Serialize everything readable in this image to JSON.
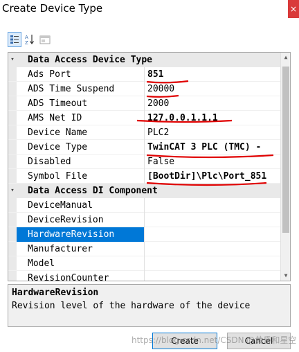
{
  "window": {
    "title": "Create Device Type",
    "close_glyph": "×"
  },
  "toolbar": {
    "categorized_icon": "categorized-view-icon",
    "alphabetical_icon": "alphabetical-sort-icon",
    "property_pages_icon": "property-pages-icon"
  },
  "grid": {
    "categories": [
      {
        "label": "Data Access Device Type",
        "properties": [
          {
            "name": "Ads Port",
            "value": "851"
          },
          {
            "name": "ADS Time Suspend",
            "value": "20000"
          },
          {
            "name": "ADS Timeout",
            "value": "2000"
          },
          {
            "name": "AMS Net ID",
            "value": "127.0.0.1.1.1"
          },
          {
            "name": "Device Name",
            "value": "PLC2"
          },
          {
            "name": "Device Type",
            "value": "TwinCAT 3 PLC (TMC) -"
          },
          {
            "name": "Disabled",
            "value": "False"
          },
          {
            "name": "Symbol File",
            "value": "[BootDir]\\Plc\\Port_851"
          }
        ]
      },
      {
        "label": "Data Access DI Component",
        "properties": [
          {
            "name": "DeviceManual",
            "value": ""
          },
          {
            "name": "DeviceRevision",
            "value": ""
          },
          {
            "name": "HardwareRevision",
            "value": ""
          },
          {
            "name": "Manufacturer",
            "value": ""
          },
          {
            "name": "Model",
            "value": ""
          },
          {
            "name": "RevisionCounter",
            "value": ""
          }
        ]
      }
    ],
    "selected_property": "HardwareRevision"
  },
  "description": {
    "title": "HardwareRevision",
    "text": "Revision level of the hardware of the device"
  },
  "buttons": {
    "create": "Create",
    "cancel": "Cancel"
  },
  "watermark": "https://blog.csdn.net/CSDN @黄昏和星空",
  "colors": {
    "selection": "#0078d7",
    "annotation_ink": "#e00000",
    "category_band": "#e9e9e9"
  }
}
